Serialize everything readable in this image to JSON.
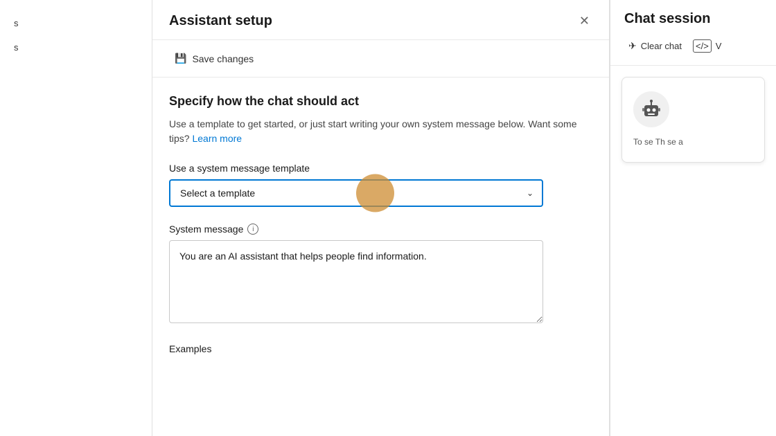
{
  "sidebar": {
    "items": [
      {
        "label": "s",
        "id": "item-1"
      },
      {
        "label": "s",
        "id": "item-2"
      }
    ]
  },
  "assistant_setup": {
    "title": "Assistant setup",
    "save_changes_label": "Save changes",
    "section_title": "Specify how the chat should act",
    "section_desc": "Use a template to get started, or just start writing your own system message below. Want some tips?",
    "learn_more_label": "Learn more",
    "template_label": "Use a system message template",
    "template_placeholder": "Select a template",
    "system_message_label": "System message",
    "system_message_value": "You are an AI assistant that helps people find information.",
    "examples_label": "Examples"
  },
  "chat_session": {
    "title": "Chat session",
    "clear_chat_label": "Clear chat",
    "view_code_label": "V",
    "bot_card_text": "To\nse\nTh\nse\na"
  },
  "icons": {
    "save": "💾",
    "close": "✕",
    "chevron_down": "⌄",
    "info": "i",
    "clear_chat": "✈",
    "view_code": "</>",
    "bot": "🤖"
  }
}
